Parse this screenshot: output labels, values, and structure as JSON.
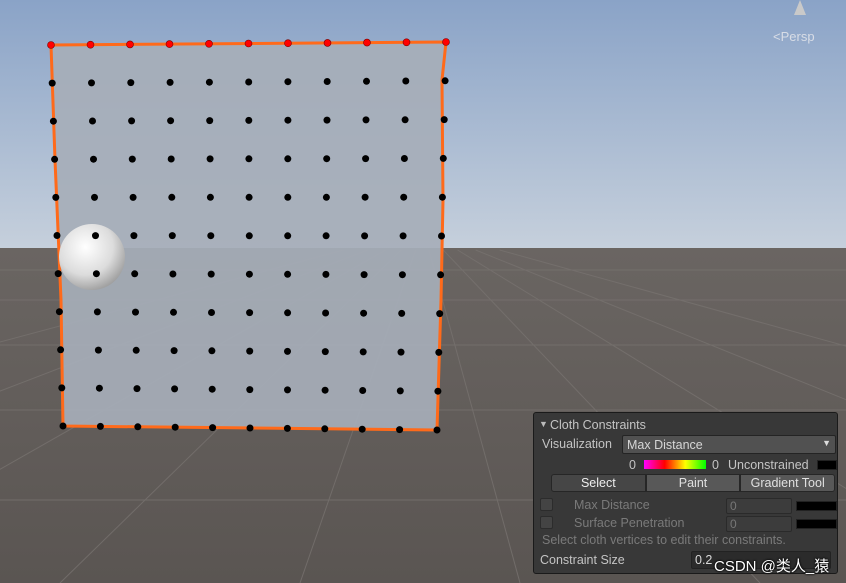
{
  "scene": {
    "view_label": "Persp",
    "vertex_grid": {
      "columns": 11,
      "rows": 11,
      "pinned_row": "top"
    },
    "colors": {
      "sky_top": "#8aa3c7",
      "sky_bottom": "#c6d0dc",
      "ground": "#5f5a57",
      "cloth": "#a6aeb8",
      "cloth_outline": "#ff6a1a",
      "vertex": "#000000",
      "pinned_vertex": "#ff0000"
    }
  },
  "panel": {
    "title": "Cloth Constraints",
    "visualization_label": "Visualization",
    "visualization_value": "Max Distance",
    "range_min": "0",
    "range_max": "0",
    "unconstrained_label": "Unconstrained",
    "tools": [
      "Select",
      "Paint",
      "Gradient Tool"
    ],
    "active_tool": "Select",
    "max_distance_label": "Max Distance",
    "max_distance_value": "0",
    "surface_penetration_label": "Surface Penetration",
    "surface_penetration_value": "0",
    "hint": "Select cloth vertices to edit their constraints.",
    "constraint_size_label": "Constraint Size",
    "constraint_size_value": "0.2"
  },
  "watermark": "CSDN @类人_猿"
}
